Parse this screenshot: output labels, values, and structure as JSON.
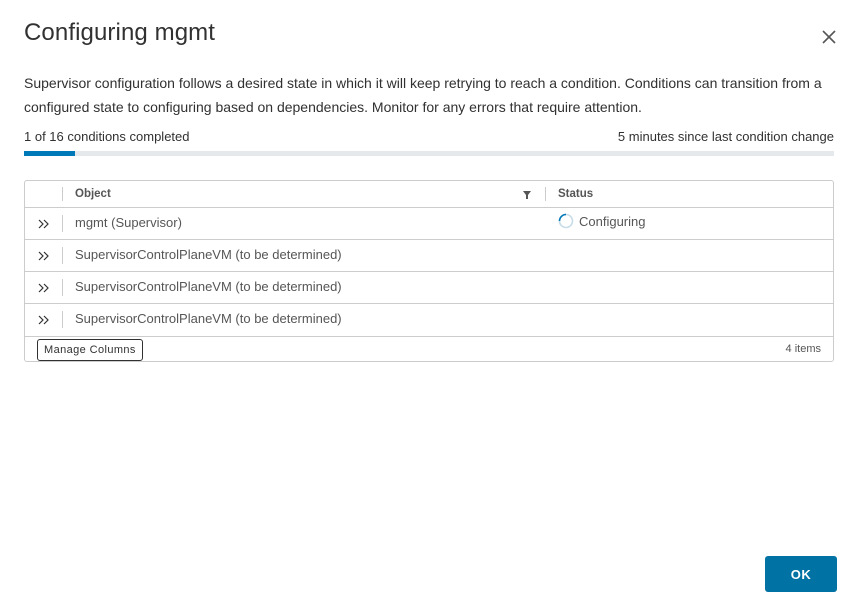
{
  "modal": {
    "title": "Configuring mgmt",
    "description": "Supervisor configuration follows a desired state in which it will keep retrying to reach a condition. Conditions can transition from a configured state to configuring based on dependencies. Monitor for any errors that require attention.",
    "close_icon": "close-icon"
  },
  "progress": {
    "completed_text": "1 of 16 conditions completed",
    "last_change_text": "5 minutes since last condition change",
    "completed": 1,
    "total": 16,
    "accent_color": "#0079b8"
  },
  "grid": {
    "columns": [
      "Object",
      "Status"
    ],
    "rows": [
      {
        "object": "mgmt (Supervisor)",
        "status": "Configuring",
        "status_icon": "spinner-icon"
      },
      {
        "object": "SupervisorControlPlaneVM (to be determined)",
        "status": ""
      },
      {
        "object": "SupervisorControlPlaneVM (to be determined)",
        "status": ""
      },
      {
        "object": "SupervisorControlPlaneVM (to be determined)",
        "status": ""
      }
    ],
    "footer": {
      "manage_columns_label": "Manage Columns",
      "items_count": "4 items"
    }
  },
  "actions": {
    "ok_label": "OK",
    "ok_color": "#0072a3"
  }
}
